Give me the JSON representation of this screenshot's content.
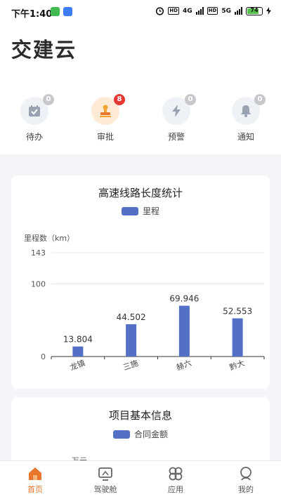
{
  "status": {
    "time": "下午1:40",
    "net1": "4G",
    "net2": "5G",
    "battery": "74"
  },
  "app_title": "交建云",
  "quick_actions": [
    {
      "label": "待办",
      "badge": "0",
      "icon": "check-calendar-icon"
    },
    {
      "label": "审批",
      "badge": "8",
      "icon": "stamp-icon"
    },
    {
      "label": "预警",
      "badge": "0",
      "icon": "lightning-icon"
    },
    {
      "label": "通知",
      "badge": "0",
      "icon": "bell-icon"
    }
  ],
  "chart_card": {
    "title": "高速线路长度统计",
    "legend": "里程",
    "y_title": "里程数（km）"
  },
  "chart_data": {
    "type": "bar",
    "title": "高速线路长度统计",
    "ylabel": "里程数（km）",
    "categories": [
      "龙镇",
      "三施",
      "赫六",
      "黔大"
    ],
    "series": [
      {
        "name": "里程",
        "values": [
          13.804,
          44.502,
          69.946,
          52.553
        ]
      }
    ],
    "data_labels": [
      "13.804",
      "44.502",
      "69.946",
      "52.553"
    ],
    "ylim": [
      0,
      143
    ],
    "yticks": [
      0,
      100,
      143
    ],
    "color": "#5470c6",
    "grid": true
  },
  "info_card": {
    "title": "项目基本信息",
    "legend": "合同金额",
    "y_title": "万元"
  },
  "tabbar": [
    {
      "label": "首页",
      "icon": "home-icon"
    },
    {
      "label": "驾驶舱",
      "icon": "monitor-icon"
    },
    {
      "label": "应用",
      "icon": "apps-icon"
    },
    {
      "label": "我的",
      "icon": "user-icon"
    }
  ],
  "colors": {
    "accent": "#e8762c",
    "bar": "#5470c6",
    "badge": "#e53935"
  }
}
